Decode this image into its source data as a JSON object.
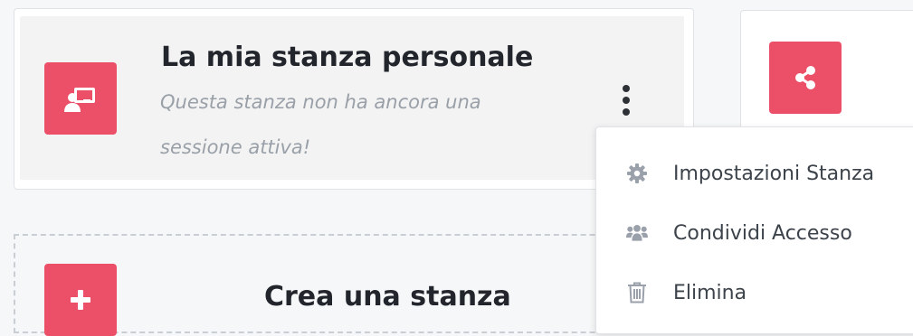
{
  "room_card": {
    "title": "La mia stanza personale",
    "status_text": "Questa stanza non ha ancora una sessione attiva!",
    "icon": "presentation-user-icon",
    "options_icon": "kebab-menu-icon"
  },
  "share_card": {
    "icon": "share-icon"
  },
  "create_card": {
    "title": "Crea una stanza",
    "icon": "plus-icon"
  },
  "room_menu": {
    "items": [
      {
        "label": "Impostazioni Stanza",
        "icon": "gear-icon"
      },
      {
        "label": "Condividi Accesso",
        "icon": "users-icon"
      },
      {
        "label": "Elimina",
        "icon": "trash-icon"
      }
    ]
  },
  "colors": {
    "accent": "#ec5068",
    "card_background": "#f3f3f3",
    "muted_text": "#9aa0a8",
    "menu_icon": "#9aa1aa"
  }
}
